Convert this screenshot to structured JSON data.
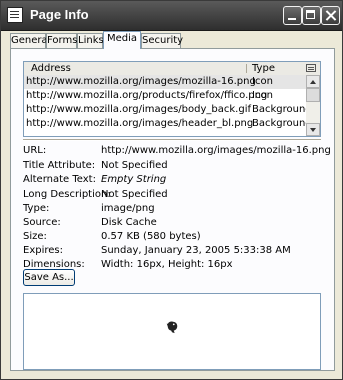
{
  "window": {
    "title": "Page Info"
  },
  "tabs": [
    {
      "label": "General"
    },
    {
      "label": "Forms"
    },
    {
      "label": "Links"
    },
    {
      "label": "Media",
      "active": true
    },
    {
      "label": "Security"
    }
  ],
  "media_list": {
    "headers": {
      "address": "Address",
      "type": "Type"
    },
    "rows": [
      {
        "url": "http://www.mozilla.org/images/mozilla-16.png",
        "type": "Icon",
        "selected": true
      },
      {
        "url": "http://www.mozilla.org/products/firefox/ffico.png",
        "type": "Icon"
      },
      {
        "url": "http://www.mozilla.org/images/body_back.gif",
        "type": "Background"
      },
      {
        "url": "http://www.mozilla.org/images/header_bl.png",
        "type": "Background"
      }
    ]
  },
  "properties": [
    {
      "label": "URL:",
      "value": "http://www.mozilla.org/images/mozilla-16.png"
    },
    {
      "label": "Title Attribute:",
      "value": "Not Specified"
    },
    {
      "label": "Alternate Text:",
      "value": "Empty String",
      "italic": true
    },
    {
      "label": "Long Description:",
      "value": "Not Specified"
    },
    {
      "label": "Type:",
      "value": "image/png"
    },
    {
      "label": "Source:",
      "value": "Disk Cache"
    },
    {
      "label": "Size:",
      "value": "0.57 KB (580 bytes)"
    },
    {
      "label": "Expires:",
      "value": "Sunday, January 23, 2005 5:33:38 AM"
    },
    {
      "label": "Dimensions:",
      "value": "Width: 16px, Height: 16px"
    }
  ],
  "actions": {
    "save_as": "Save As..."
  },
  "icons": {
    "app": "page-info-icon",
    "minimize": "minimize-icon",
    "maximize": "maximize-icon",
    "close": "close-icon",
    "column_picker": "column-picker-icon",
    "preview": "mozilla-dinosaur-icon"
  },
  "colors": {
    "titlebar": "#3c3c3c",
    "selected_row": "#e5e5e5",
    "dialog_bg": "#ece9d8"
  }
}
